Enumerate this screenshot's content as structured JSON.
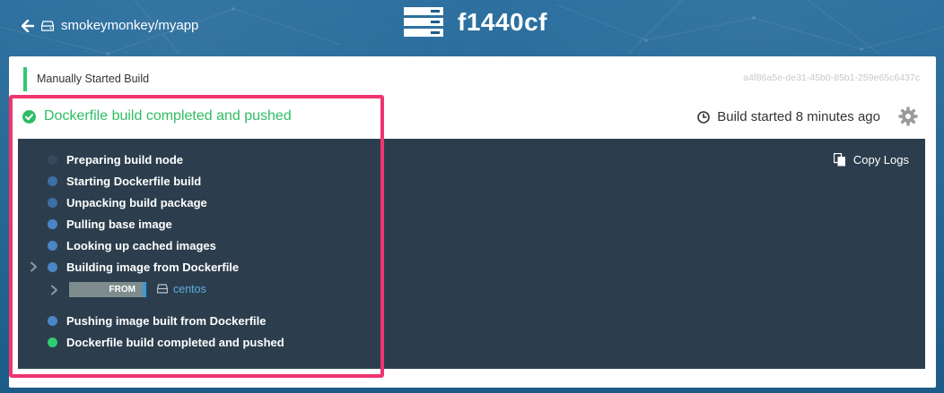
{
  "header": {
    "back_icon": "arrow-left-icon",
    "repo_icon": "repository-icon",
    "repo_name": "smokeymonkey/myapp",
    "build_icon": "server-stack-icon",
    "build_id": "f1440cf"
  },
  "build": {
    "trigger": "Manually Started Build",
    "uuid": "a4f86a5e-de31-45b0-85b1-259e65c6437c",
    "status": "Dockerfile build completed and pushed",
    "started": "Build started 8 minutes ago",
    "settings_icon": "gear-icon"
  },
  "logs": {
    "copy_label": "Copy Logs",
    "phases": [
      {
        "label": "Preparing build node",
        "color": "#34495e"
      },
      {
        "label": "Starting Dockerfile build",
        "color": "#3d6fa3"
      },
      {
        "label": "Unpacking build package",
        "color": "#3d6fa3"
      },
      {
        "label": "Pulling base image",
        "color": "#4a86c5"
      },
      {
        "label": "Looking up cached images",
        "color": "#4a86c5"
      },
      {
        "label": "Building image from Dockerfile",
        "color": "#4a86c5"
      },
      {
        "label": "Pushing image built from Dockerfile",
        "color": "#4a86c5"
      },
      {
        "label": "Dockerfile build completed and pushed",
        "color": "#2ecc71"
      }
    ],
    "command": {
      "keyword": "FROM",
      "image": "centos"
    }
  },
  "colors": {
    "success": "#2fbd63",
    "highlight": "#f0356f",
    "log_bg": "#2c3e4d"
  }
}
